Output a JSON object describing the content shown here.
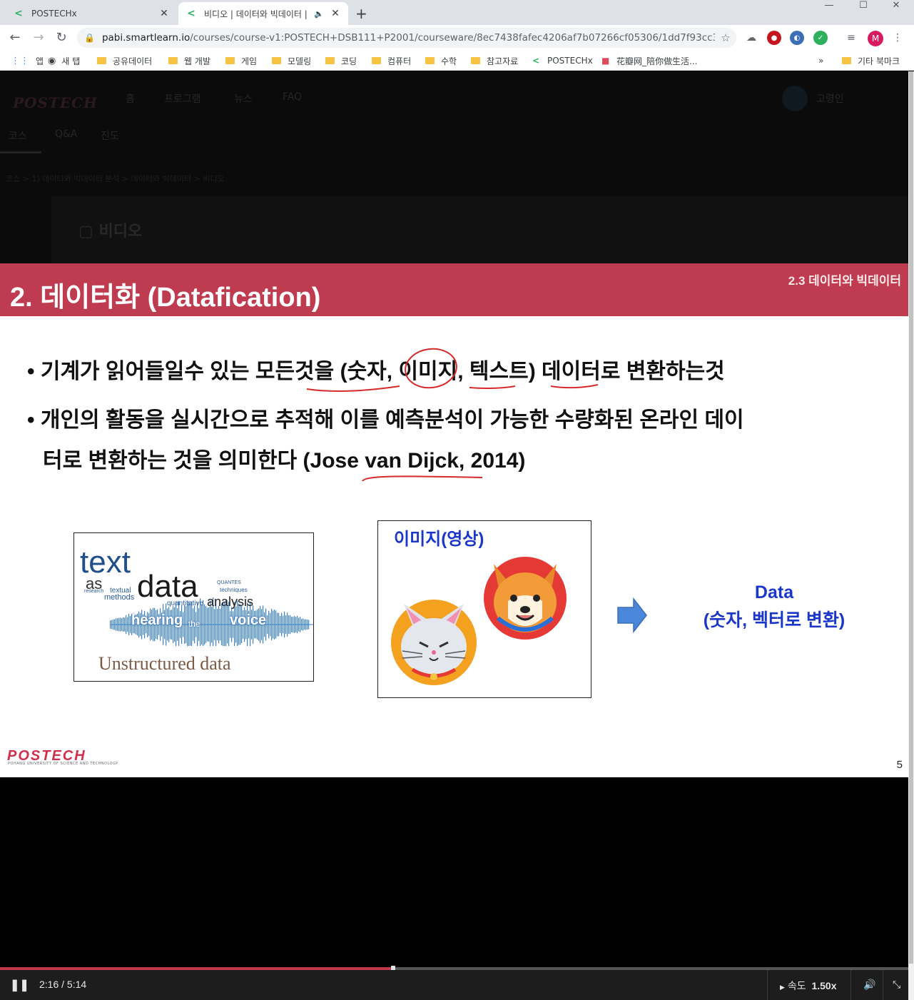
{
  "browser": {
    "tabs": [
      {
        "title": "POSTECHx",
        "active": false
      },
      {
        "title": "비디오 | 데이터와 빅데이터 |",
        "active": true
      }
    ],
    "url_host": "pabi.smartlearn.io",
    "url_path": "/courses/course-v1:POSTECH+DSB111+P2001/courseware/8ec7438fafec4206af7b07266cf05306/1dd7f93cc3a940a185...",
    "profile_initial": "M",
    "bookmarks": [
      {
        "label": "앱",
        "type": "apps"
      },
      {
        "label": "새 탭",
        "type": "globe"
      },
      {
        "label": "공유데이터",
        "type": "folder"
      },
      {
        "label": "웹 개발",
        "type": "folder"
      },
      {
        "label": "게임",
        "type": "folder"
      },
      {
        "label": "모델링",
        "type": "folder"
      },
      {
        "label": "코딩",
        "type": "folder"
      },
      {
        "label": "컴퓨터",
        "type": "folder"
      },
      {
        "label": "수학",
        "type": "folder"
      },
      {
        "label": "참고자료",
        "type": "folder"
      },
      {
        "label": "POSTECHx",
        "type": "site"
      },
      {
        "label": "花瓣网_陪你做生活...",
        "type": "site2"
      }
    ],
    "more": "»",
    "other_bookmarks": "기타 북마크"
  },
  "site": {
    "logo": "POSTECH",
    "nav": [
      "홈",
      "프로그램",
      "뉴스",
      "FAQ"
    ],
    "username": "고령인",
    "course_tabs": [
      "코스",
      "Q&A",
      "진도"
    ],
    "breadcrumb": "코스  >  1) 데이터와 빅데이터 분석 >  데이터와 빅데이터  >  비디오",
    "video_heading": "비디오"
  },
  "slide": {
    "title": "2. 데이터화 (Datafication)",
    "section": "2.3 데이터와 빅데이터",
    "bullet1": "• 기계가 읽어들일수 있는 모든것을 (숫자, 이미지, 텍스트) 데이터로 변환하는것",
    "bullet2a": "• 개인의 활동을 실시간으로 추적해 이를 예측분석이 가능한 수량화된 온라인 데이",
    "bullet2b": "터로 변환하는 것을 의미한다 (Jose van Dijck, 2014)",
    "wordcloud": {
      "text": "text",
      "as": "as",
      "data": "data",
      "textual": "textual",
      "methods": "methods",
      "research": "research",
      "quantitative": "quantitative",
      "analysis": "analysis",
      "techniques": "techniques",
      "quantes": "QUANTES",
      "hearing": "hearing",
      "the": "the",
      "voice": "voice"
    },
    "unstructured": "Unstructured data",
    "image_title": "이미지(영상)",
    "data_line1": "Data",
    "data_line2": "(숫자, 벡터로 변환)",
    "logo": "POSTECH",
    "logo_sub": "POHANG UNIVERSITY OF SCIENCE AND TECHNOLOGY",
    "page_number": "5"
  },
  "player": {
    "time": "2:16 / 5:14",
    "progress": 0.4331,
    "speed_label": "속도",
    "speed_value": "1.50x"
  },
  "colors": {
    "banner": "#bf3b4f",
    "accent_blue": "#1a37c9",
    "progress": "#c1384e"
  }
}
